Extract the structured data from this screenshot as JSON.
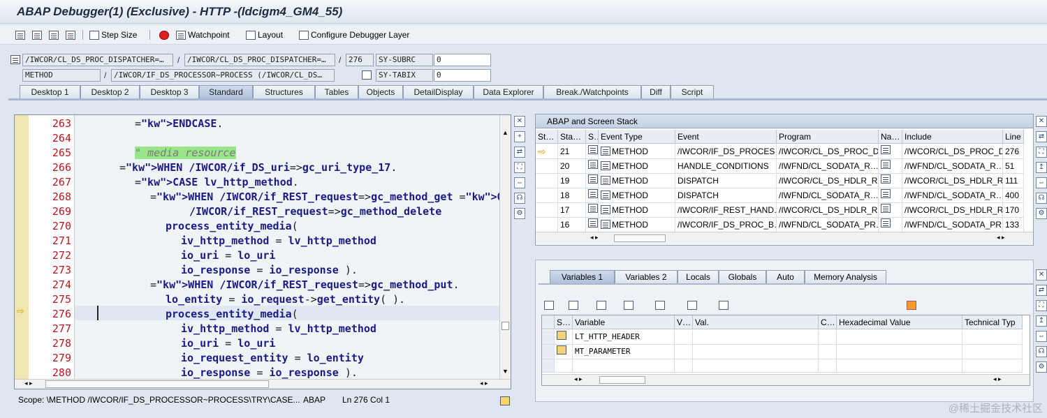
{
  "window": {
    "title": "ABAP Debugger(1)  (Exclusive) - HTTP -(ldcigm4_GM4_55)"
  },
  "toolbar": {
    "step_size": "Step Size",
    "watchpoint": "Watchpoint",
    "layout": "Layout",
    "configure_layer": "Configure Debugger Layer"
  },
  "context": {
    "program1": "/IWCOR/CL_DS_PROC_DISPATCHER=…",
    "program2": "/IWCOR/CL_DS_PROC_DISPATCHER=…",
    "line": "276",
    "sy1_name": "SY-SUBRC",
    "sy1_value": "0",
    "event_type": "METHOD",
    "event_name": "/IWCOR/IF_DS_PROCESSOR~PROCESS (/IWCOR/CL_DS…",
    "sy2_name": "SY-TABIX",
    "sy2_value": "0"
  },
  "tabs": [
    "Desktop 1",
    "Desktop 2",
    "Desktop 3",
    "Standard",
    "Structures",
    "Tables",
    "Objects",
    "DetailDisplay",
    "Data Explorer",
    "Break./Watchpoints",
    "Diff",
    "Script"
  ],
  "editor": {
    "line_numbers": [
      "263",
      "264",
      "265",
      "266",
      "267",
      "268",
      "269",
      "270",
      "271",
      "272",
      "273",
      "274",
      "275",
      "276",
      "277",
      "278",
      "279",
      "280"
    ],
    "current_line": "276",
    "scope": "Scope: \\METHOD /IWCOR/IF_DS_PROCESSOR~PROCESS\\TRY\\CASE...",
    "language": "ABAP",
    "position": "Ln 276 Col   1",
    "lines": [
      [
        "ENDCASE."
      ],
      [
        ""
      ],
      [
        "\" media resource"
      ],
      [
        "WHEN /IWCOR/if_DS_uri=>gc_uri_type_17."
      ],
      [
        "CASE lv_http_method."
      ],
      [
        "WHEN /IWCOR/if_REST_request=>gc_method_get OR"
      ],
      [
        "/IWCOR/if_REST_request=>gc_method_delete"
      ],
      [
        "process_entity_media("
      ],
      [
        "iv_http_method = lv_http_method"
      ],
      [
        "io_uri = lo_uri"
      ],
      [
        "io_response = io_response )."
      ],
      [
        "WHEN /IWCOR/if_REST_request=>gc_method_put."
      ],
      [
        "lo_entity = io_request->get_entity( )."
      ],
      [
        "process_entity_media("
      ],
      [
        "iv_http_method = lv_http_method"
      ],
      [
        "io_uri = lo_uri"
      ],
      [
        "io_request_entity = lo_entity"
      ],
      [
        "io_response = io_response )."
      ]
    ]
  },
  "stack": {
    "title": "ABAP and Screen Stack",
    "columns": [
      "St…",
      "Sta…",
      "S…",
      "Event Type",
      "Event",
      "Program",
      "Na…",
      "Include",
      "Line"
    ],
    "rows": [
      {
        "current": true,
        "level": "21",
        "type": "METHOD",
        "event": "/IWCOR/IF_DS_PROCES…",
        "program": "/IWCOR/CL_DS_PROC_D…",
        "include": "/IWCOR/CL_DS_PROC_D…",
        "line": "276"
      },
      {
        "current": false,
        "level": "20",
        "type": "METHOD",
        "event": "HANDLE_CONDITIONS",
        "program": "/IWFND/CL_SODATA_R…",
        "include": "/IWFND/CL_SODATA_R…",
        "line": "51"
      },
      {
        "current": false,
        "level": "19",
        "type": "METHOD",
        "event": "DISPATCH",
        "program": "/IWCOR/CL_DS_HDLR_R…",
        "include": "/IWCOR/CL_DS_HDLR_R…",
        "line": "111"
      },
      {
        "current": false,
        "level": "18",
        "type": "METHOD",
        "event": "DISPATCH",
        "program": "/IWFND/CL_SODATA_R…",
        "include": "/IWFND/CL_SODATA_R…",
        "line": "400"
      },
      {
        "current": false,
        "level": "17",
        "type": "METHOD",
        "event": "/IWCOR/IF_REST_HAND…",
        "program": "/IWCOR/CL_DS_HDLR_R…",
        "include": "/IWCOR/CL_DS_HDLR_R…",
        "line": "170"
      },
      {
        "current": false,
        "level": "16",
        "type": "METHOD",
        "event": "/IWCOR/IF_DS_PROC_B…",
        "program": "/IWFND/CL_SODATA_PR…",
        "include": "/IWFND/CL_SODATA_PR…",
        "line": "133"
      }
    ]
  },
  "vartabs": [
    "Variables 1",
    "Variables 2",
    "Locals",
    "Globals",
    "Auto",
    "Memory Analysis"
  ],
  "vars": {
    "columns": [
      "S…",
      "Variable",
      "V…",
      "Val.",
      "C…",
      "Hexadecimal Value",
      "Technical Typ"
    ],
    "rows": [
      {
        "name": "LT_HTTP_HEADER"
      },
      {
        "name": "MT_PARAMETER"
      },
      {
        "name": ""
      }
    ]
  },
  "watermark": "@稀土掘金技术社区"
}
